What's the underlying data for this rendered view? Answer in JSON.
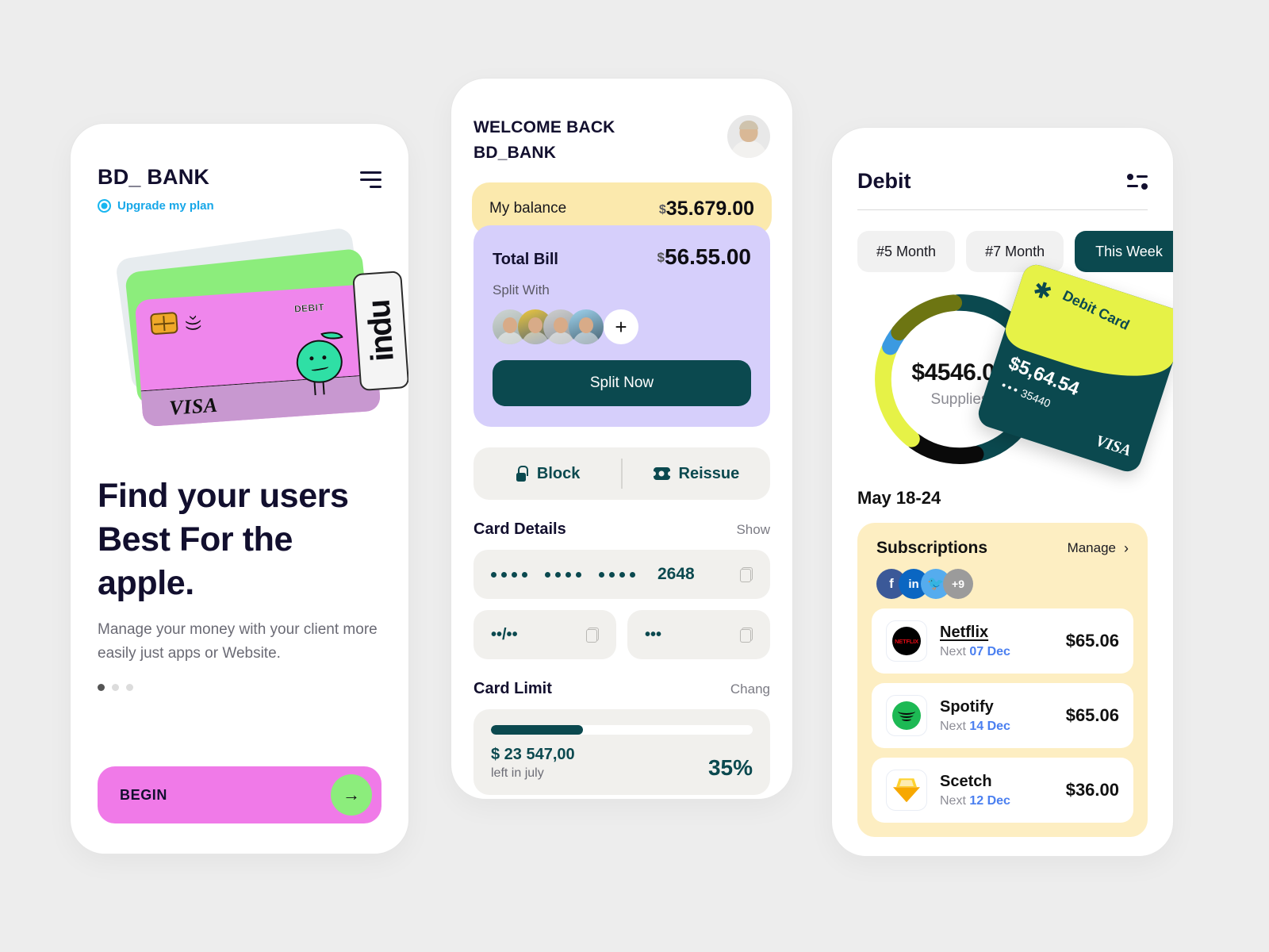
{
  "left_phone": {
    "brand": "BD_ BANK",
    "menu_icon": "hamburger-icon",
    "upgrade_label": "Upgrade my plan",
    "card_art": {
      "debit_label": "DEBIT",
      "visa_label": "VISA",
      "tag_text": "indu"
    },
    "headline": "Find your users Best For the apple.",
    "subcopy": "Manage your money with your client more easily just apps or Website.",
    "carousel_dots": 3,
    "carousel_active": 0,
    "cta_label": "BEGIN",
    "cta_arrow": "arrow-right-icon"
  },
  "mid_phone": {
    "welcome_line1": "WELCOME BACK",
    "welcome_line2": "BD_BANK",
    "balance": {
      "label": "My balance",
      "currency": "$",
      "amount": "35.679.00"
    },
    "bill": {
      "label": "Total Bill",
      "currency": "$",
      "amount": "56.55.00",
      "split_with_label": "Split With",
      "add_icon": "plus-icon",
      "split_button": "Split Now",
      "participants": 4
    },
    "actions": {
      "block": "Block",
      "reissue": "Reissue"
    },
    "card_details": {
      "title": "Card Details",
      "action": "Show",
      "last4": "2648",
      "expiry_mask": "••/••",
      "cvv_mask": "•••",
      "copy_icon": "copy-icon"
    },
    "card_limit": {
      "title": "Card Limit",
      "action": "Chang",
      "progress": 35,
      "amount": "$  23  547,00",
      "sub": "left in july",
      "percent": "35%"
    }
  },
  "right_phone": {
    "title": "Debit",
    "filter_icon": "filter-icon",
    "tabs": [
      {
        "label": "#5 Month",
        "active": false
      },
      {
        "label": "#7 Month",
        "active": false
      },
      {
        "label": "This Week",
        "active": true
      }
    ],
    "donut": {
      "amount": "$4546.00",
      "label": "Supplies"
    },
    "debit_card": {
      "star_icon": "star-icon",
      "title": "Debit Card",
      "amount": "$5,64.54",
      "number": "35440",
      "network": "VISA"
    },
    "date_range": "May 18-24",
    "subscriptions": {
      "title": "Subscriptions",
      "manage_label": "Manage",
      "chevron_icon": "chevron-right-icon",
      "brand_icons": [
        "facebook-icon",
        "linkedin-icon",
        "twitter-icon"
      ],
      "more_count": "+9",
      "items": [
        {
          "name": "Netflix",
          "next_label": "Next",
          "next_date": "07 Dec",
          "price": "$65.06",
          "logo": "netflix-logo"
        },
        {
          "name": "Spotify",
          "next_label": "Next",
          "next_date": "14 Dec",
          "price": "$65.06",
          "logo": "spotify-logo"
        },
        {
          "name": "Scetch",
          "next_label": "Next",
          "next_date": "12 Dec",
          "price": "$36.00",
          "logo": "sketch-logo"
        }
      ]
    }
  },
  "chart_data": {
    "type": "pie",
    "title": "Supplies",
    "center_value": "$4546.00",
    "categories": [
      "Teal",
      "Black",
      "Yellow",
      "Blue",
      "Olive"
    ],
    "values": [
      40,
      12,
      18,
      3,
      12
    ],
    "colors": [
      "#0b494f",
      "#0a0a0a",
      "#e6f247",
      "#3b9ae1",
      "#6d7512"
    ],
    "legend": "none",
    "grid": false
  },
  "theme": {
    "background": "#ededed",
    "ink": "#120f2e",
    "teal": "#0b494f",
    "pink": "#f07ae8",
    "green": "#8ced7c",
    "lilac": "#d6cffb",
    "cream": "#fbe9ad",
    "butter": "#fdeec2",
    "lime": "#e6f247"
  }
}
